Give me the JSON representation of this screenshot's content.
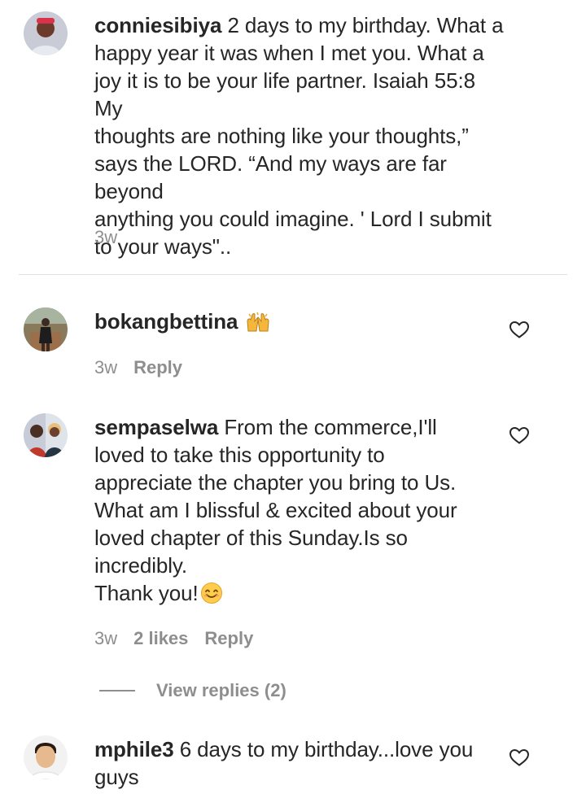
{
  "comments": [
    {
      "username": "conniesibiya",
      "lines": [
        "2 days to my birthday. What a",
        "happy year it was when I met you. What a",
        "joy it is to be your life partner. Isaiah 55:8 My",
        "thoughts are nothing like your thoughts,”",
        "says the LORD. “And my ways are far beyond",
        "anything you could imagine. ' Lord I submit",
        "to your ways\".."
      ],
      "time": "3w",
      "avatar_icon": "profile-photo"
    },
    {
      "username": "bokangbettina",
      "lines": [
        ""
      ],
      "emoji": "raising-hands-emoji",
      "time": "3w",
      "reply_label": "Reply",
      "avatar_icon": "profile-photo"
    },
    {
      "username": "sempaselwa",
      "lines": [
        "From the commerce,I'll",
        "loved to take this opportunity to",
        "appreciate the chapter you bring to Us.",
        "What am I blissful & excited about your",
        "loved chapter of this Sunday.Is so",
        "incredibly.",
        "Thank you!"
      ],
      "emoji": "smiling-face-emoji",
      "time": "3w",
      "likes": "2 likes",
      "reply_label": "Reply",
      "view_replies": "View replies (2)",
      "avatar_icon": "profile-photo"
    },
    {
      "username": "mphile3",
      "lines": [
        "6 days to my birthday...love you",
        "guys"
      ],
      "avatar_icon": "profile-photo"
    }
  ],
  "icons": {
    "like": "heart-outline-icon"
  },
  "colors": {
    "text": "#262626",
    "secondary": "#8e8e8e",
    "divider": "#e0e0e0"
  }
}
